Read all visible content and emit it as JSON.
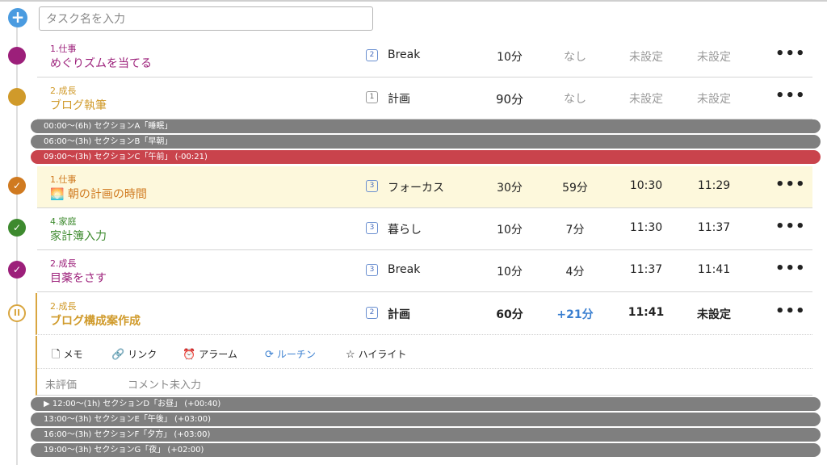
{
  "input": {
    "placeholder": "タスク名を入力"
  },
  "tasks_top": [
    {
      "category": "1.仕事",
      "title": "めぐりズムを当てる",
      "badge": "2",
      "mode": "Break",
      "estimate": "10分",
      "actual": "なし",
      "start": "未設定",
      "end": "未設定",
      "color": "#9c1f7a"
    },
    {
      "category": "2.成長",
      "title": "ブログ執筆",
      "badge": "1",
      "mode": "計画",
      "estimate": "90分",
      "actual": "なし",
      "start": "未設定",
      "end": "未設定",
      "color": "#d09a2a"
    }
  ],
  "sections_top": [
    {
      "label": "00:00〜(6h) セクションA「睡眠」"
    },
    {
      "label": "06:00〜(3h) セクションB「早朝」"
    },
    {
      "label": "09:00〜(3h) セクションC「午前」 (-00:21)"
    }
  ],
  "tasks_mid": [
    {
      "category": "1.仕事",
      "title": "🌅 朝の計画の時間",
      "badge": "3",
      "mode": "フォーカス",
      "estimate": "30分",
      "actual": "59分",
      "start": "10:30",
      "end": "11:29",
      "color": "#d07a20"
    },
    {
      "category": "4.家庭",
      "title": "家計簿入力",
      "badge": "3",
      "mode": "暮らし",
      "estimate": "10分",
      "actual": "7分",
      "start": "11:30",
      "end": "11:37",
      "color": "#3d8a2e"
    },
    {
      "category": "2.成長",
      "title": "目薬をさす",
      "badge": "3",
      "mode": "Break",
      "estimate": "10分",
      "actual": "4分",
      "start": "11:37",
      "end": "11:41",
      "color": "#9c1f7a"
    },
    {
      "category": "2.成長",
      "title": "ブログ構成案作成",
      "badge": "2",
      "mode": "計画",
      "estimate": "60分",
      "actual": "+21分",
      "start": "11:41",
      "end": "未設定",
      "color": "#d09a2a"
    }
  ],
  "detail": {
    "memo": "メモ",
    "link": "リンク",
    "alarm": "アラーム",
    "routine": "ルーチン",
    "highlight": "ハイライト",
    "eval": "未評価",
    "comment": "コメント未入力"
  },
  "sections_bottom": [
    {
      "label": "▶ 12:00〜(1h) セクションD「お昼」 (+00:40)"
    },
    {
      "label": "13:00〜(3h) セクションE「午後」 (+03:00)"
    },
    {
      "label": "16:00〜(3h) セクションF「夕方」 (+03:00)"
    },
    {
      "label": "19:00〜(3h) セクションG「夜」 (+02:00)"
    }
  ],
  "more_label": "•••",
  "add_label": "+",
  "check_glyph": "✓",
  "pause_glyph": "II"
}
